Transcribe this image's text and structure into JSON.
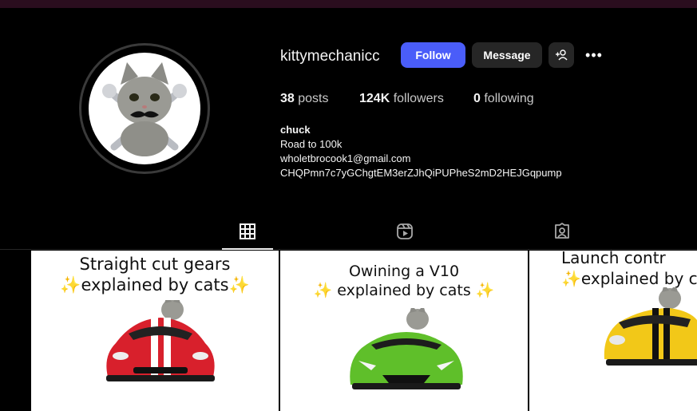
{
  "profile": {
    "username": "kittymechanicc",
    "follow_label": "Follow",
    "message_label": "Message",
    "more_label": "•••",
    "stats": {
      "posts_count": "38",
      "posts_label": "posts",
      "followers_count": "124K",
      "followers_label": "followers",
      "following_count": "0",
      "following_label": "following"
    },
    "bio": {
      "name": "chuck",
      "line1": "Road to 100k",
      "line2": "wholetbrocook1@gmail.com",
      "line3": "CHQPmn7c7yGChgtEM3erZJhQiPUPheS2mD2HEJGqpump"
    }
  },
  "colors": {
    "follow_button": "#4a5df9",
    "secondary_button": "#262626",
    "background": "#000000",
    "top_bar": "#2a0d1e"
  },
  "tabs": [
    {
      "name": "posts",
      "icon": "grid-icon",
      "active": true
    },
    {
      "name": "reels",
      "icon": "reels-icon",
      "active": false
    },
    {
      "name": "tagged",
      "icon": "tagged-icon",
      "active": false
    }
  ],
  "posts": [
    {
      "line1": "Straight cut gears",
      "line2": "✨explained by cats✨",
      "car_color": "#d8202c"
    },
    {
      "line1": "Owining a V10",
      "line2": "✨ explained by cats ✨",
      "car_color": "#5fbf2a"
    },
    {
      "line1": "Launch contr",
      "line2": "✨explained by c",
      "car_color": "#f2c818"
    }
  ]
}
